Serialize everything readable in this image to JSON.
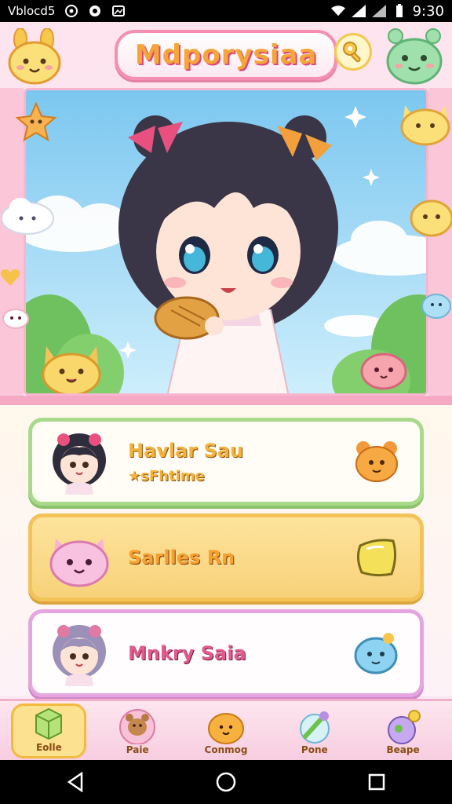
{
  "status_bar": {
    "left_text": "Vblocd5",
    "time": "9:30"
  },
  "header": {
    "title": "Mdporysiaa"
  },
  "cards": [
    {
      "title": "Havlar Sau",
      "subtitle": "sFhtime"
    },
    {
      "title": "Sarlles Rn",
      "subtitle": ""
    },
    {
      "title": "Mnkry Saia",
      "subtitle": ""
    }
  ],
  "bottom_nav": [
    {
      "label": "Eolle",
      "icon": "gem-cube-icon",
      "active": true
    },
    {
      "label": "Paie",
      "icon": "bear-icon",
      "active": false
    },
    {
      "label": "Conmog",
      "icon": "orange-blob-icon",
      "active": false
    },
    {
      "label": "Pone",
      "icon": "wand-icon",
      "active": false
    },
    {
      "label": "Beape",
      "icon": "potion-bag-icon",
      "active": false
    }
  ],
  "colors": {
    "frame_pink": "#f48fb1",
    "card_green": "#a9d98a",
    "card_gold": "#f3c35a",
    "card_purple": "#e5a6df",
    "title_orange": "#f4a63b"
  }
}
